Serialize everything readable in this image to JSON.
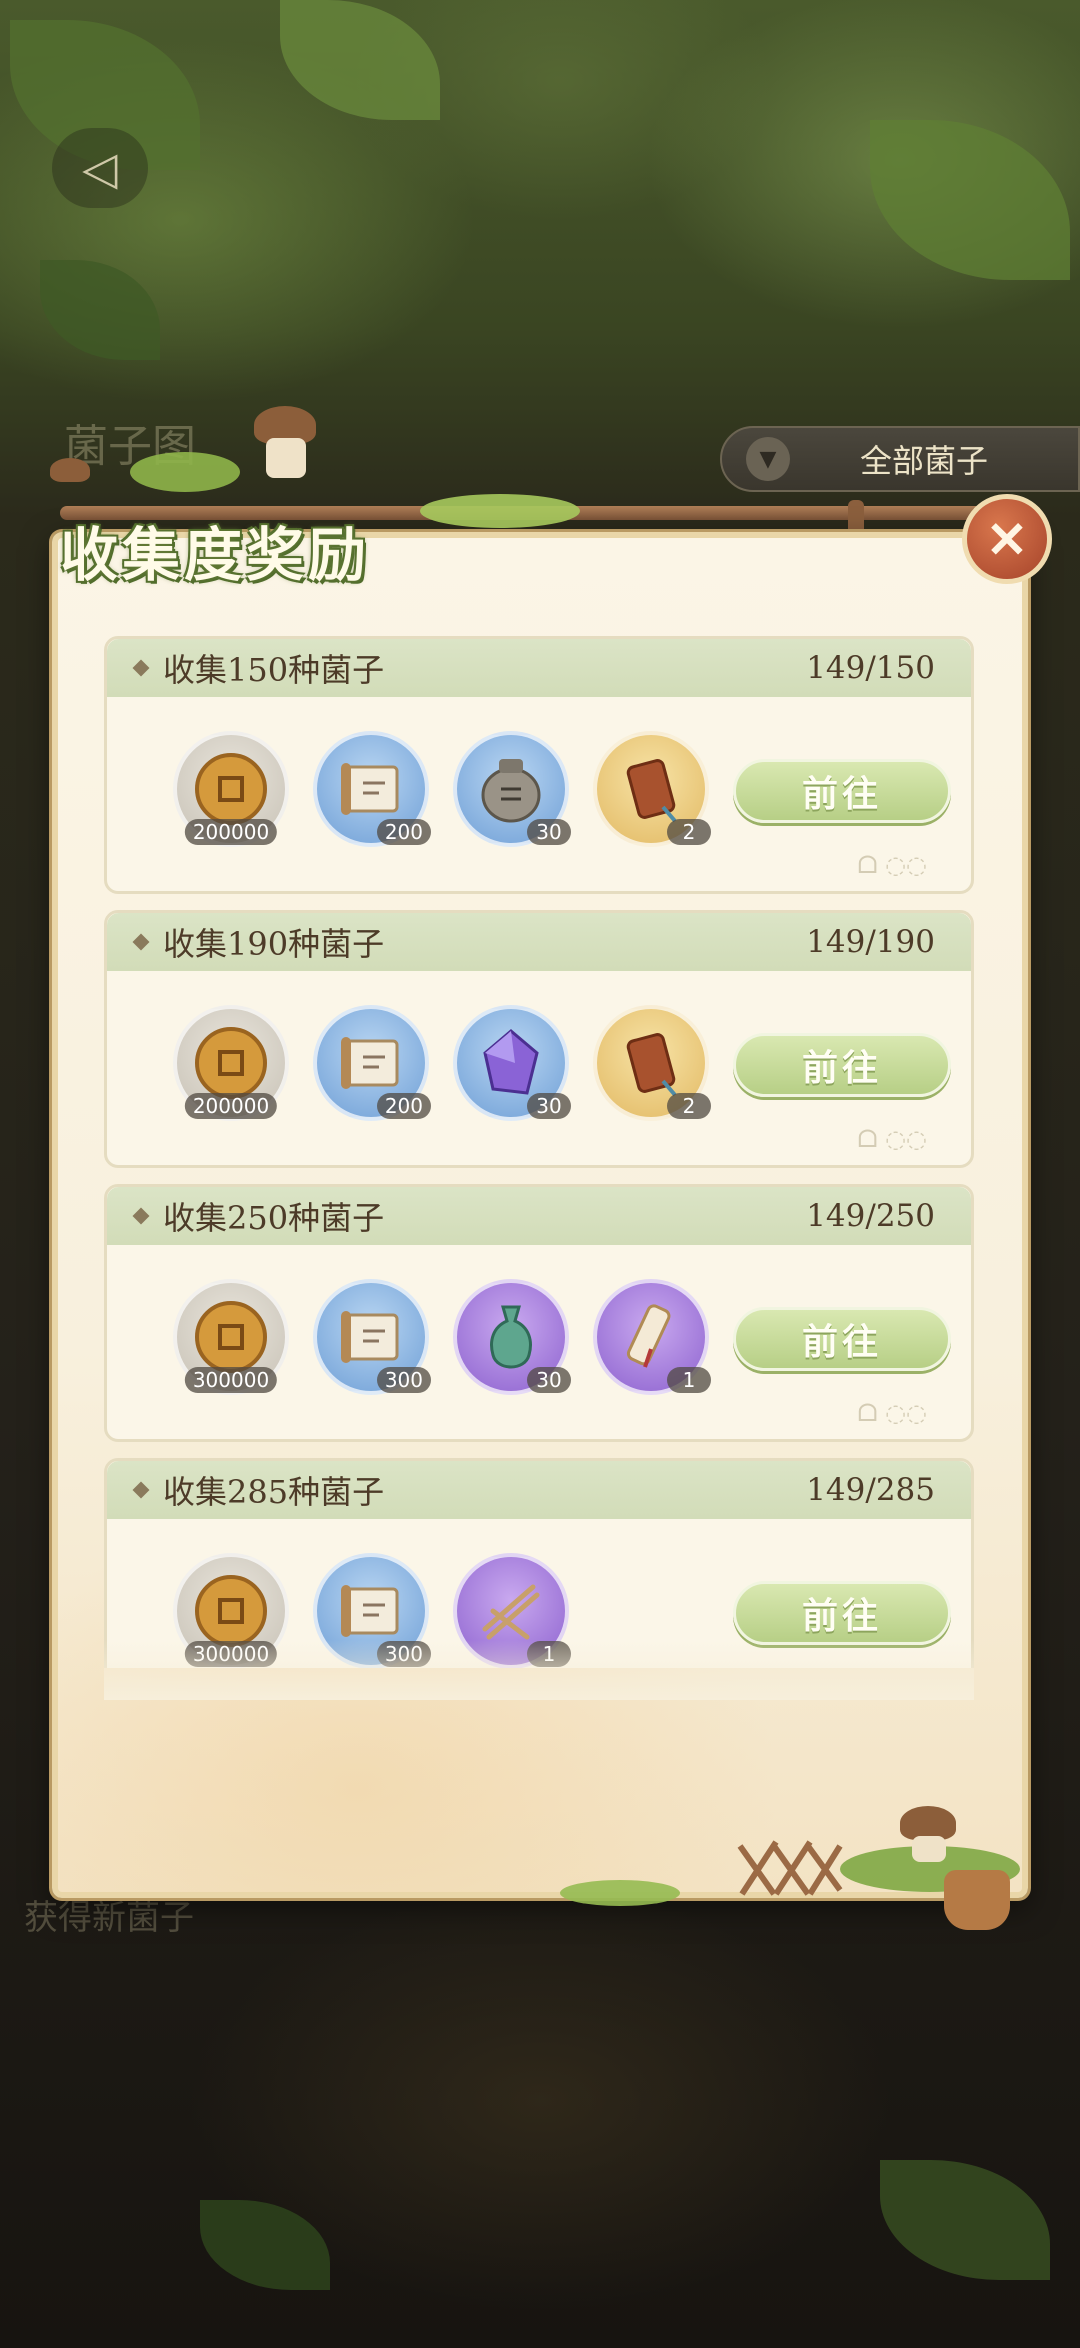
{
  "header": {
    "back_icon": "back-arrow-icon",
    "background_title": "菌子图",
    "filter_label": "全部菌子",
    "background_footer_text": "获得新菌子"
  },
  "panel": {
    "title": "收集度奖励",
    "close_icon": "close-x-icon"
  },
  "rewards": [
    {
      "title": "收集150种菌子",
      "progress": "149/150",
      "button_label": "前往",
      "items": [
        {
          "icon": "copper-coin-icon",
          "qty": "200000",
          "style": "gray"
        },
        {
          "icon": "scroll-icon",
          "qty": "200",
          "style": "blue"
        },
        {
          "icon": "clay-jar-icon",
          "qty": "30",
          "style": "blue"
        },
        {
          "icon": "wooden-tag-icon",
          "qty": "2",
          "style": "gold"
        }
      ]
    },
    {
      "title": "收集190种菌子",
      "progress": "149/190",
      "button_label": "前往",
      "items": [
        {
          "icon": "copper-coin-icon",
          "qty": "200000",
          "style": "gray"
        },
        {
          "icon": "scroll-icon",
          "qty": "200",
          "style": "blue"
        },
        {
          "icon": "purple-crystal-icon",
          "qty": "30",
          "style": "blue"
        },
        {
          "icon": "wooden-tag-icon",
          "qty": "2",
          "style": "gold"
        }
      ]
    },
    {
      "title": "收集250种菌子",
      "progress": "149/250",
      "button_label": "前往",
      "items": [
        {
          "icon": "copper-coin-icon",
          "qty": "300000",
          "style": "gray"
        },
        {
          "icon": "scroll-icon",
          "qty": "300",
          "style": "blue"
        },
        {
          "icon": "jade-vase-icon",
          "qty": "30",
          "style": "purple"
        },
        {
          "icon": "sealed-scroll-icon",
          "qty": "1",
          "style": "purple"
        }
      ]
    },
    {
      "title": "收集285种菌子",
      "progress": "149/285",
      "button_label": "前往",
      "items": [
        {
          "icon": "copper-coin-icon",
          "qty": "300000",
          "style": "gray"
        },
        {
          "icon": "scroll-icon",
          "qty": "300",
          "style": "blue"
        },
        {
          "icon": "chopsticks-icon",
          "qty": "1",
          "style": "purple"
        }
      ]
    }
  ],
  "colors": {
    "button_green": "#b7cf86",
    "card_header": "#d2dcb8",
    "panel_bg": "#f8f0dd",
    "close_button": "#a5432a"
  }
}
